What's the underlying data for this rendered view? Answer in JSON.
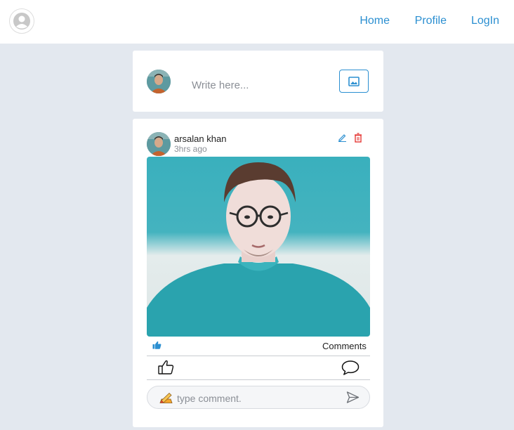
{
  "nav": {
    "links": [
      {
        "label": "Home"
      },
      {
        "label": "Profile"
      },
      {
        "label": "LogIn"
      }
    ]
  },
  "composer": {
    "placeholder": "Write here..."
  },
  "post": {
    "author": "arsalan khan",
    "time": "3hrs ago",
    "comments_label": "Comments",
    "comment_placeholder": "type comment."
  },
  "colors": {
    "accent": "#2b8fd1",
    "delete": "#e53935",
    "page_bg": "#e3e8ef",
    "card_bg": "#ffffff"
  },
  "icons": [
    "user-icon",
    "image-icon",
    "edit-icon",
    "delete-icon",
    "thumbs-up-icon",
    "comment-icon",
    "send-icon",
    "pencil-emoji-icon"
  ]
}
